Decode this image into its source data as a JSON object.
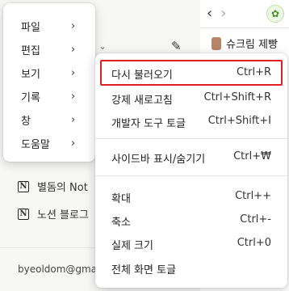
{
  "background": {
    "page_title": "슈크림 제빵",
    "brand_icon": "leaf-icon",
    "rows": [
      {
        "label": "별돔의 Not"
      },
      {
        "label": "노션 블로그"
      }
    ],
    "email": "byeoldom@gmai"
  },
  "menu": {
    "items": [
      {
        "label": "파일"
      },
      {
        "label": "편집"
      },
      {
        "label": "보기"
      },
      {
        "label": "기록"
      },
      {
        "label": "창"
      },
      {
        "label": "도움말"
      }
    ]
  },
  "submenu": {
    "groups": [
      [
        {
          "label": "다시 불러오기",
          "shortcut": "Ctrl+R"
        },
        {
          "label": "강제 새로고침",
          "shortcut": "Ctrl+Shift+R"
        },
        {
          "label": "개발자 도구 토글",
          "shortcut": "Ctrl+Shift+I"
        }
      ],
      [
        {
          "label": "사이드바 표시/숨기기",
          "shortcut": "Ctrl+₩"
        }
      ],
      [
        {
          "label": "확대",
          "shortcut": "Ctrl++"
        },
        {
          "label": "축소",
          "shortcut": "Ctrl+-"
        },
        {
          "label": "실제 크기",
          "shortcut": "Ctrl+0"
        },
        {
          "label": "전체 화면 토글",
          "shortcut": ""
        }
      ]
    ],
    "highlight_color": "#e02020"
  }
}
